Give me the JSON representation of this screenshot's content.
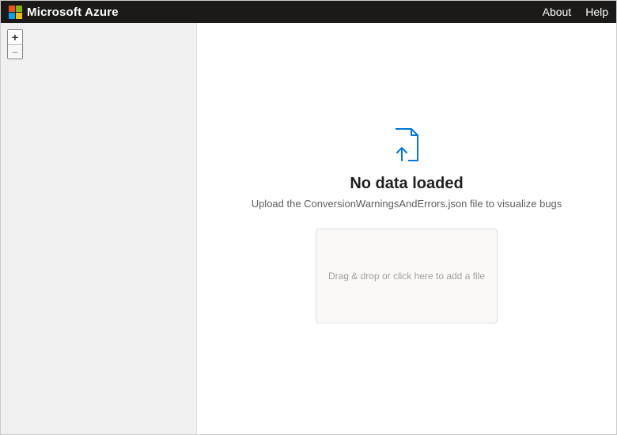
{
  "header": {
    "brand": "Microsoft Azure",
    "nav": {
      "about": "About",
      "help": "Help"
    }
  },
  "zoom": {
    "in": "+",
    "out": "−"
  },
  "main": {
    "title": "No data loaded",
    "subtitle": "Upload the ConversionWarningsAndErrors.json file to visualize bugs",
    "dropzone": "Drag & drop or click here to add a file"
  },
  "icons": {
    "file_upload": "file-upload-icon"
  }
}
